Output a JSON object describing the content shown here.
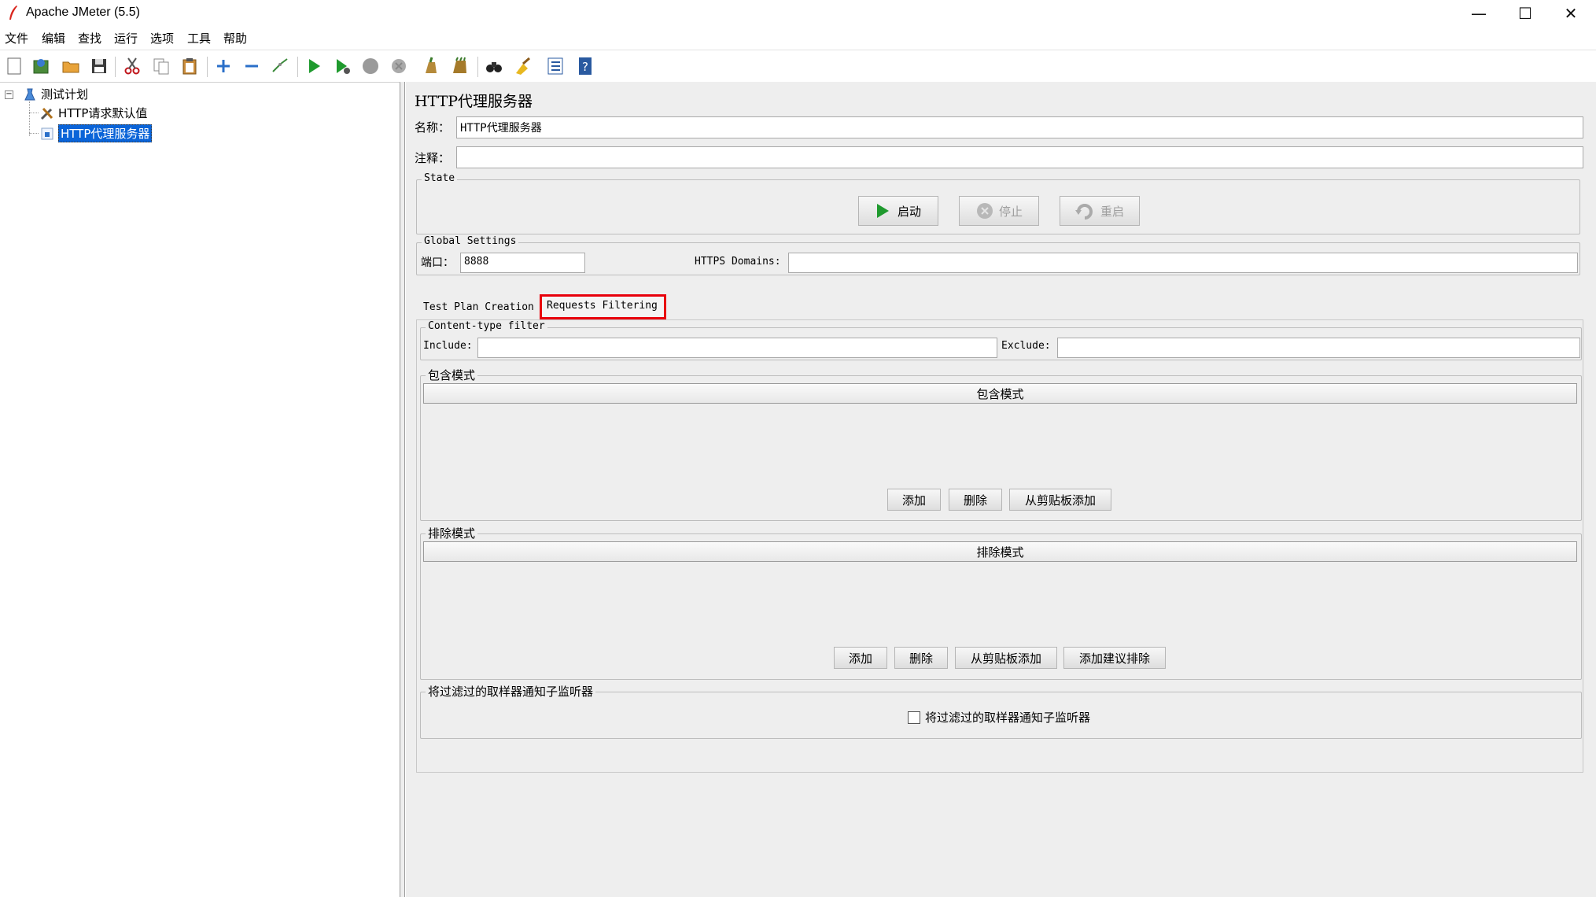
{
  "window": {
    "title": "Apache JMeter (5.5)",
    "minimize": "—",
    "maximize": "☐",
    "close": "✕"
  },
  "menu": [
    "文件",
    "编辑",
    "查找",
    "运行",
    "选项",
    "工具",
    "帮助"
  ],
  "toolbar": {
    "icons": [
      "new-icon",
      "templates-icon",
      "open-icon",
      "save-icon",
      "cut-icon",
      "copy-icon",
      "paste-icon",
      "expand-icon",
      "collapse-icon",
      "toggle-icon",
      "start-icon",
      "start-no-pause-icon",
      "stop-icon",
      "shutdown-icon",
      "clear-icon",
      "clear-all-icon",
      "search-icon",
      "reset-search-icon",
      "function-helper-icon",
      "help-icon"
    ]
  },
  "tree": {
    "root": "测试计划",
    "children": [
      "HTTP请求默认值",
      "HTTP代理服务器"
    ],
    "selected": "HTTP代理服务器"
  },
  "panel": {
    "title": "HTTP代理服务器",
    "name_label": "名称：",
    "name_value": "HTTP代理服务器",
    "comment_label": "注释：",
    "comment_value": "",
    "state": {
      "title": "State",
      "start": "启动",
      "stop": "停止",
      "restart": "重启"
    },
    "global": {
      "title": "Global Settings",
      "port_label": "端口：",
      "port_value": "8888",
      "https_label": "HTTPS Domains:",
      "https_value": ""
    },
    "tabs": [
      "Test Plan Creation",
      "Requests Filtering"
    ],
    "active_tab": "Requests Filtering",
    "content_filter": {
      "title": "Content-type filter",
      "include_label": "Include:",
      "include_value": "",
      "exclude_label": "Exclude:",
      "exclude_value": ""
    },
    "include_patterns": {
      "title": "包含模式",
      "header": "包含模式",
      "add": "添加",
      "delete": "删除",
      "add_clipboard": "从剪贴板添加"
    },
    "exclude_patterns": {
      "title": "排除模式",
      "header": "排除模式",
      "add": "添加",
      "delete": "删除",
      "add_clipboard": "从剪贴板添加",
      "add_suggested": "添加建议排除"
    },
    "notify": {
      "title": "将过滤过的取样器通知子监听器",
      "checkbox_label": "将过滤过的取样器通知子监听器",
      "checked": false
    }
  },
  "colors": {
    "highlight": "#e8000b",
    "selection": "#0a64d8",
    "panel_bg": "#eeeeee"
  }
}
